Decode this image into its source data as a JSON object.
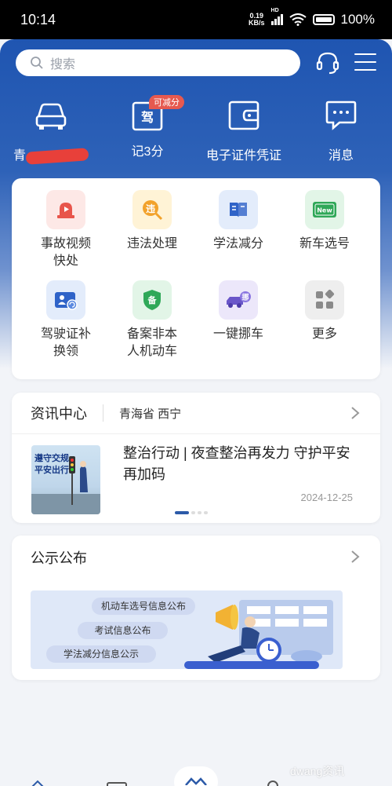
{
  "status_bar": {
    "time": "10:14",
    "net_speed_value": "0.19",
    "net_speed_unit": "KB/s",
    "signal_label": "HD",
    "battery": "100%"
  },
  "header": {
    "search_placeholder": "搜索",
    "quick_actions": [
      {
        "label": "青",
        "icon": "car-icon"
      },
      {
        "label": "记3分",
        "badge": "可减分",
        "icon": "license-icon"
      },
      {
        "label": "电子证件凭证",
        "icon": "wallet-icon"
      },
      {
        "label": "消息",
        "icon": "message-icon"
      }
    ]
  },
  "services": [
    {
      "label": "事故视频快处",
      "line1": "事故视频",
      "line2": "快处",
      "icon": "alarm-video-icon",
      "color": "#fde8e6",
      "accent": "#e8554b"
    },
    {
      "label": "违法处理",
      "line1": "违法处理",
      "line2": "",
      "icon": "violation-search-icon",
      "color": "#fff3d6",
      "accent": "#f2a22b"
    },
    {
      "label": "学法减分",
      "line1": "学法减分",
      "line2": "",
      "icon": "book-icon",
      "color": "#e3ecfb",
      "accent": "#2f63c8"
    },
    {
      "label": "新车选号",
      "line1": "新车选号",
      "line2": "",
      "icon": "new-plate-icon",
      "color": "#e2f5e7",
      "accent": "#2fa858"
    },
    {
      "label": "驾驶证补换领",
      "line1": "驾驶证补",
      "line2": "换领",
      "icon": "id-card-icon",
      "color": "#e3ecfb",
      "accent": "#2f63c8"
    },
    {
      "label": "备案非本人机动车",
      "line1": "备案非本",
      "line2": "人机动车",
      "icon": "shield-icon",
      "color": "#e2f5e7",
      "accent": "#2fa858"
    },
    {
      "label": "一键挪车",
      "line1": "一键挪车",
      "line2": "",
      "icon": "move-car-icon",
      "color": "#ece7fa",
      "accent": "#6a56c9"
    },
    {
      "label": "更多",
      "line1": "更多",
      "line2": "",
      "icon": "more-grid-icon",
      "color": "#eeeeee",
      "accent": "#8a8a8a"
    }
  ],
  "news": {
    "title": "资讯中心",
    "location": "青海省 西宁",
    "headline": "整治行动 | 夜查整治再发力 守护平安再加码",
    "date": "2024-12-25",
    "image_text_1": "遵守交规",
    "image_text_2": "平安出行"
  },
  "publications": {
    "title": "公示公布",
    "items": [
      "机动车选号信息公布",
      "考试信息公布",
      "学法减分信息公示"
    ]
  },
  "watermark": "dwang资讯"
}
